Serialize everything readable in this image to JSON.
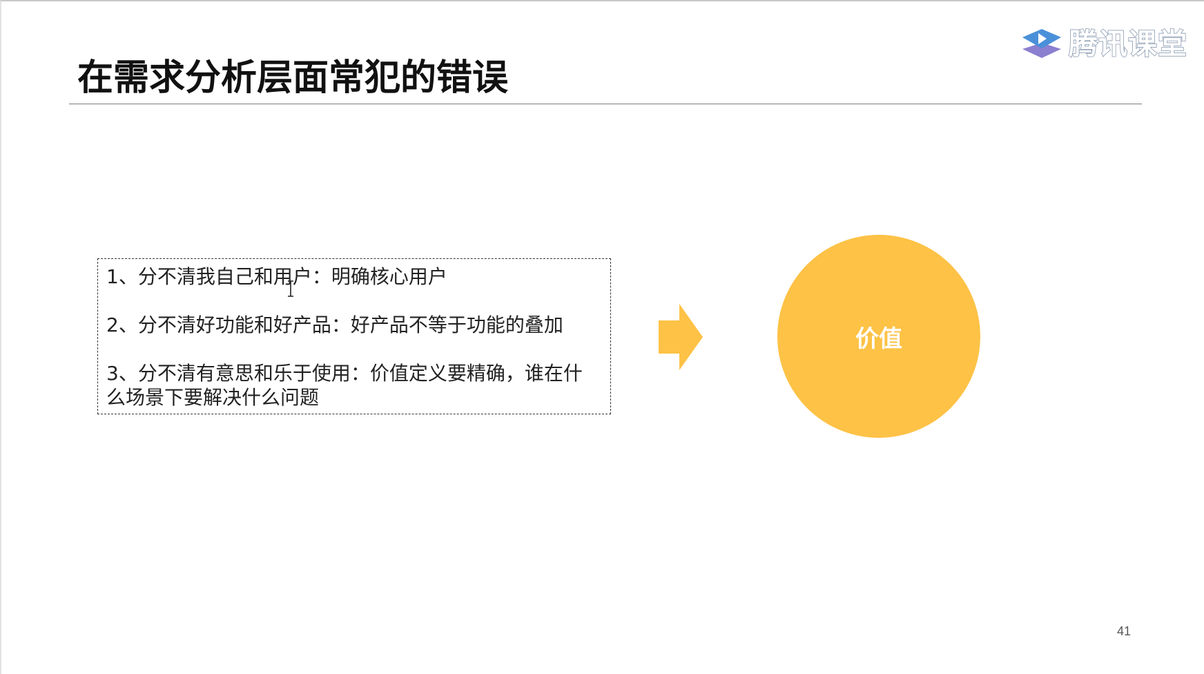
{
  "brand": {
    "logo_text": "腾讯课堂",
    "logo_icon": "tencent-classroom-icon"
  },
  "slide": {
    "title": "在需求分析层面常犯的错误",
    "points": [
      "1、分不清我自己和用户：明确核心用户",
      "2、分不清好功能和好产品：好产品不等于功能的叠加",
      "3、分不清有意思和乐于使用：价值定义要精确，谁在什么场景下要解决什么问题"
    ],
    "arrow_icon": "right-arrow-icon",
    "circle_label": "价值",
    "page_number": "41"
  },
  "colors": {
    "accent_yellow": "#fdc246",
    "title_text": "#111111",
    "body_text": "#222222",
    "logo_blue": "#4a90d9",
    "logo_purple": "#8b7fd0"
  },
  "cursor_icon": "text-cursor-icon"
}
